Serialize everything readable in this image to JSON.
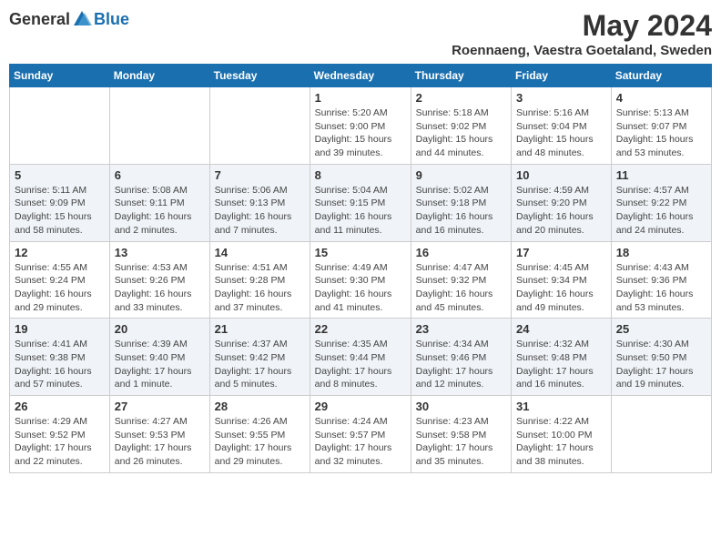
{
  "logo": {
    "general": "General",
    "blue": "Blue"
  },
  "header": {
    "month": "May 2024",
    "location": "Roennaeng, Vaestra Goetaland, Sweden"
  },
  "weekdays": [
    "Sunday",
    "Monday",
    "Tuesday",
    "Wednesday",
    "Thursday",
    "Friday",
    "Saturday"
  ],
  "weeks": [
    [
      {
        "day": "",
        "info": ""
      },
      {
        "day": "",
        "info": ""
      },
      {
        "day": "",
        "info": ""
      },
      {
        "day": "1",
        "info": "Sunrise: 5:20 AM\nSunset: 9:00 PM\nDaylight: 15 hours and 39 minutes."
      },
      {
        "day": "2",
        "info": "Sunrise: 5:18 AM\nSunset: 9:02 PM\nDaylight: 15 hours and 44 minutes."
      },
      {
        "day": "3",
        "info": "Sunrise: 5:16 AM\nSunset: 9:04 PM\nDaylight: 15 hours and 48 minutes."
      },
      {
        "day": "4",
        "info": "Sunrise: 5:13 AM\nSunset: 9:07 PM\nDaylight: 15 hours and 53 minutes."
      }
    ],
    [
      {
        "day": "5",
        "info": "Sunrise: 5:11 AM\nSunset: 9:09 PM\nDaylight: 15 hours and 58 minutes."
      },
      {
        "day": "6",
        "info": "Sunrise: 5:08 AM\nSunset: 9:11 PM\nDaylight: 16 hours and 2 minutes."
      },
      {
        "day": "7",
        "info": "Sunrise: 5:06 AM\nSunset: 9:13 PM\nDaylight: 16 hours and 7 minutes."
      },
      {
        "day": "8",
        "info": "Sunrise: 5:04 AM\nSunset: 9:15 PM\nDaylight: 16 hours and 11 minutes."
      },
      {
        "day": "9",
        "info": "Sunrise: 5:02 AM\nSunset: 9:18 PM\nDaylight: 16 hours and 16 minutes."
      },
      {
        "day": "10",
        "info": "Sunrise: 4:59 AM\nSunset: 9:20 PM\nDaylight: 16 hours and 20 minutes."
      },
      {
        "day": "11",
        "info": "Sunrise: 4:57 AM\nSunset: 9:22 PM\nDaylight: 16 hours and 24 minutes."
      }
    ],
    [
      {
        "day": "12",
        "info": "Sunrise: 4:55 AM\nSunset: 9:24 PM\nDaylight: 16 hours and 29 minutes."
      },
      {
        "day": "13",
        "info": "Sunrise: 4:53 AM\nSunset: 9:26 PM\nDaylight: 16 hours and 33 minutes."
      },
      {
        "day": "14",
        "info": "Sunrise: 4:51 AM\nSunset: 9:28 PM\nDaylight: 16 hours and 37 minutes."
      },
      {
        "day": "15",
        "info": "Sunrise: 4:49 AM\nSunset: 9:30 PM\nDaylight: 16 hours and 41 minutes."
      },
      {
        "day": "16",
        "info": "Sunrise: 4:47 AM\nSunset: 9:32 PM\nDaylight: 16 hours and 45 minutes."
      },
      {
        "day": "17",
        "info": "Sunrise: 4:45 AM\nSunset: 9:34 PM\nDaylight: 16 hours and 49 minutes."
      },
      {
        "day": "18",
        "info": "Sunrise: 4:43 AM\nSunset: 9:36 PM\nDaylight: 16 hours and 53 minutes."
      }
    ],
    [
      {
        "day": "19",
        "info": "Sunrise: 4:41 AM\nSunset: 9:38 PM\nDaylight: 16 hours and 57 minutes."
      },
      {
        "day": "20",
        "info": "Sunrise: 4:39 AM\nSunset: 9:40 PM\nDaylight: 17 hours and 1 minute."
      },
      {
        "day": "21",
        "info": "Sunrise: 4:37 AM\nSunset: 9:42 PM\nDaylight: 17 hours and 5 minutes."
      },
      {
        "day": "22",
        "info": "Sunrise: 4:35 AM\nSunset: 9:44 PM\nDaylight: 17 hours and 8 minutes."
      },
      {
        "day": "23",
        "info": "Sunrise: 4:34 AM\nSunset: 9:46 PM\nDaylight: 17 hours and 12 minutes."
      },
      {
        "day": "24",
        "info": "Sunrise: 4:32 AM\nSunset: 9:48 PM\nDaylight: 17 hours and 16 minutes."
      },
      {
        "day": "25",
        "info": "Sunrise: 4:30 AM\nSunset: 9:50 PM\nDaylight: 17 hours and 19 minutes."
      }
    ],
    [
      {
        "day": "26",
        "info": "Sunrise: 4:29 AM\nSunset: 9:52 PM\nDaylight: 17 hours and 22 minutes."
      },
      {
        "day": "27",
        "info": "Sunrise: 4:27 AM\nSunset: 9:53 PM\nDaylight: 17 hours and 26 minutes."
      },
      {
        "day": "28",
        "info": "Sunrise: 4:26 AM\nSunset: 9:55 PM\nDaylight: 17 hours and 29 minutes."
      },
      {
        "day": "29",
        "info": "Sunrise: 4:24 AM\nSunset: 9:57 PM\nDaylight: 17 hours and 32 minutes."
      },
      {
        "day": "30",
        "info": "Sunrise: 4:23 AM\nSunset: 9:58 PM\nDaylight: 17 hours and 35 minutes."
      },
      {
        "day": "31",
        "info": "Sunrise: 4:22 AM\nSunset: 10:00 PM\nDaylight: 17 hours and 38 minutes."
      },
      {
        "day": "",
        "info": ""
      }
    ]
  ]
}
